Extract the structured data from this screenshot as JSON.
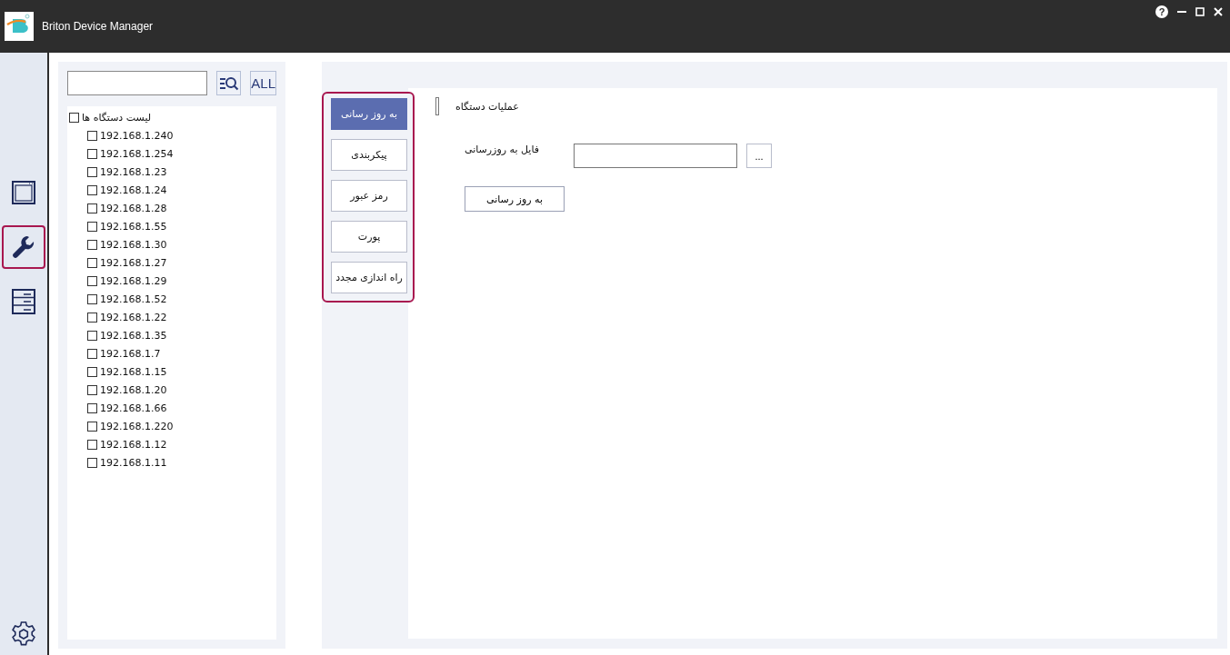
{
  "window": {
    "title": "Briton Device Manager",
    "controls": {
      "help": "?"
    }
  },
  "rail": {
    "items": [
      {
        "kind": "window",
        "selected": false
      },
      {
        "kind": "tools",
        "selected": true
      },
      {
        "kind": "list",
        "selected": false
      }
    ],
    "settings": {
      "kind": "gear"
    }
  },
  "device_panel": {
    "all_button": "ALL",
    "tree": {
      "label": "لیست دستگاه ها",
      "checked": false,
      "children": [
        {
          "label": "192.168.1.240",
          "checked": false
        },
        {
          "label": "192.168.1.254",
          "checked": false
        },
        {
          "label": "192.168.1.23",
          "checked": false
        },
        {
          "label": "192.168.1.24",
          "checked": false
        },
        {
          "label": "192.168.1.28",
          "checked": false
        },
        {
          "label": "192.168.1.55",
          "checked": false
        },
        {
          "label": "192.168.1.30",
          "checked": false
        },
        {
          "label": "192.168.1.27",
          "checked": false
        },
        {
          "label": "192.168.1.29",
          "checked": false
        },
        {
          "label": "192.168.1.52",
          "checked": false
        },
        {
          "label": "192.168.1.22",
          "checked": false
        },
        {
          "label": "192.168.1.35",
          "checked": false
        },
        {
          "label": "192.168.1.7",
          "checked": false
        },
        {
          "label": "192.168.1.15",
          "checked": false
        },
        {
          "label": "192.168.1.20",
          "checked": false
        },
        {
          "label": "192.168.1.66",
          "checked": false
        },
        {
          "label": "192.168.1.220",
          "checked": false
        },
        {
          "label": "192.168.1.12",
          "checked": false
        },
        {
          "label": "192.168.1.11",
          "checked": false
        }
      ]
    }
  },
  "operations": {
    "menu": [
      {
        "label": "به روز رسانی",
        "selected": true
      },
      {
        "label": "پیکربندی",
        "selected": false
      },
      {
        "label": "رمز عبور",
        "selected": false
      },
      {
        "label": "پورت",
        "selected": false
      },
      {
        "label": "راه اندازی مجدد",
        "selected": false
      }
    ],
    "section_title": "عملیات دستگاه",
    "file_label": "فایل به روزرسانی",
    "browse_button": "...",
    "update_button": "به روز رسانی"
  }
}
